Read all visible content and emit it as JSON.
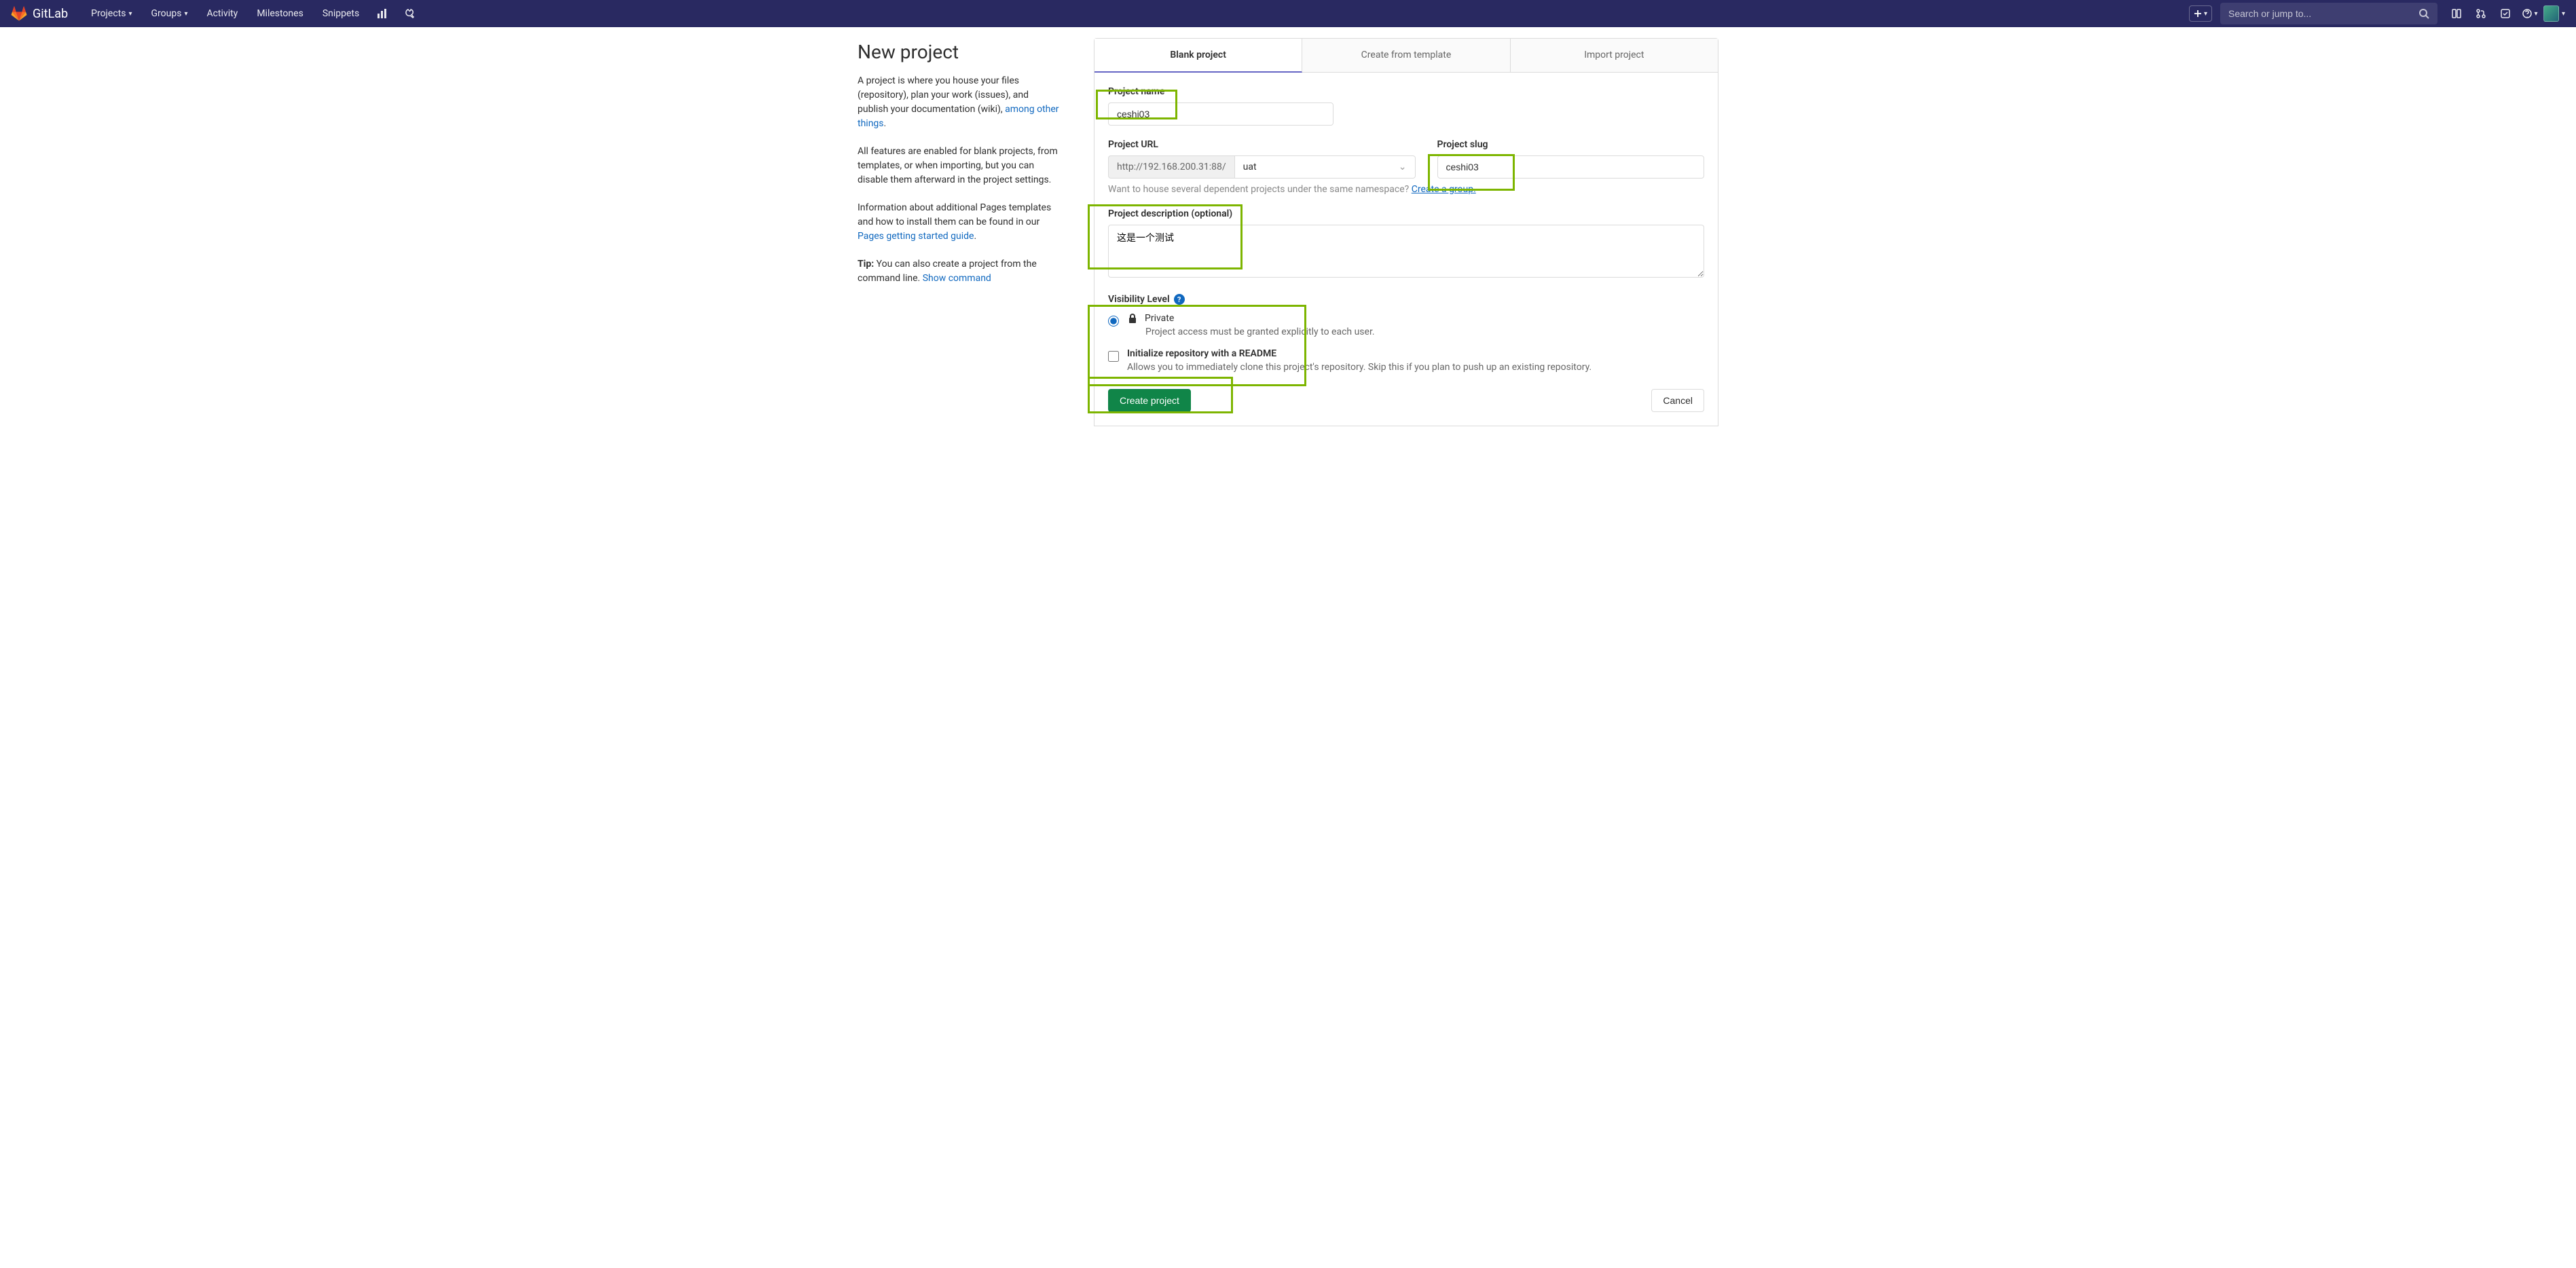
{
  "navbar": {
    "brand": "GitLab",
    "items": [
      "Projects",
      "Groups",
      "Activity",
      "Milestones",
      "Snippets"
    ],
    "search_placeholder": "Search or jump to..."
  },
  "sidebar": {
    "title": "New project",
    "p1_prefix": "A project is where you house your files (repository), plan your work (issues), and publish your documentation (wiki), ",
    "p1_link": "among other things",
    "p2": "All features are enabled for blank projects, from templates, or when importing, but you can disable them afterward in the project settings.",
    "p3_prefix": "Information about additional Pages templates and how to install them can be found in our ",
    "p3_link": "Pages getting started guide",
    "tip_label": "Tip:",
    "tip_text": " You can also create a project from the command line. ",
    "tip_link": "Show command"
  },
  "tabs": [
    "Blank project",
    "Create from template",
    "Import project"
  ],
  "form": {
    "name_label": "Project name",
    "name_value": "ceshi03",
    "url_label": "Project URL",
    "url_prefix": "http://192.168.200.31:88/",
    "url_namespace": "uat",
    "slug_label": "Project slug",
    "slug_value": "ceshi03",
    "namespace_hint_prefix": "Want to house several dependent projects under the same namespace? ",
    "namespace_hint_link": "Create a group.",
    "desc_label": "Project description (optional)",
    "desc_value": "这是一个测试",
    "visibility_label": "Visibility Level",
    "visibility_private_title": "Private",
    "visibility_private_desc": "Project access must be granted explicitly to each user.",
    "readme_title": "Initialize repository with a README",
    "readme_desc": "Allows you to immediately clone this project's repository. Skip this if you plan to push up an existing repository.",
    "create_button": "Create project",
    "cancel_button": "Cancel"
  }
}
